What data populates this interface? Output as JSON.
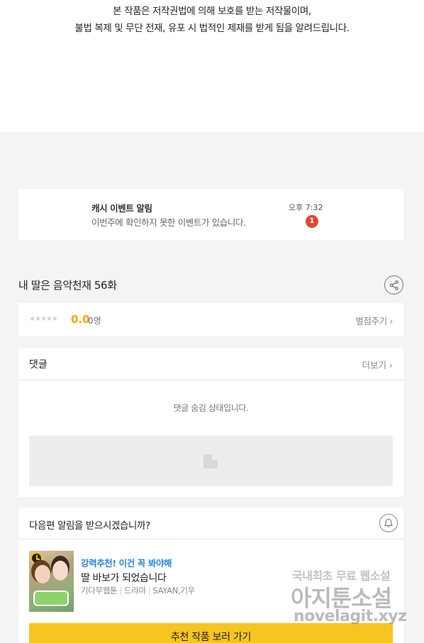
{
  "notice": {
    "line1": "본 작품은 저작권법에 의해 보호를 받는 저작물이며,",
    "line2": "불법 복제 및 무단 전재, 유포 시 법적인 제재를 받게 됨을 알려드립니다."
  },
  "event": {
    "title": "캐시 이벤트 알림",
    "description": "이번주에 확인하지 못한 이벤트가 있습니다.",
    "time": "오후 7:32",
    "badge_count": "1"
  },
  "episode": {
    "title": "내 딸은 음악천재 56화",
    "share_icon": "share-icon"
  },
  "rating": {
    "stars": "★★★★★",
    "star_fill": 0,
    "score": "0.0",
    "count": "0명",
    "action_label": "별점주기 ›"
  },
  "comments": {
    "label": "댓글",
    "more_label": "더보기 ›",
    "hidden_message": "댓글 숨김 상태입니다."
  },
  "next": {
    "label": "다음편 알림을 받으시겠습니까?",
    "bell_icon": "bell-icon",
    "recommend": {
      "tag": "강력추천! 이건 꼭 봐야해",
      "title": "딸 바보가 되었습니다",
      "genre1": "기다무웹툰",
      "genre2": "드라마",
      "authors": "SAYAN,기우"
    },
    "button_label": "추천 작품 보러 가기"
  },
  "watermark": {
    "line1": "국내최초 무료 웹소설",
    "line2": "아지툰소설",
    "line3": "novelagit.xyz"
  },
  "colors": {
    "accent_yellow": "#f7c520",
    "score_color": "#f5a800",
    "tag_blue": "#2a86e0",
    "badge_red": "#e2492f"
  }
}
